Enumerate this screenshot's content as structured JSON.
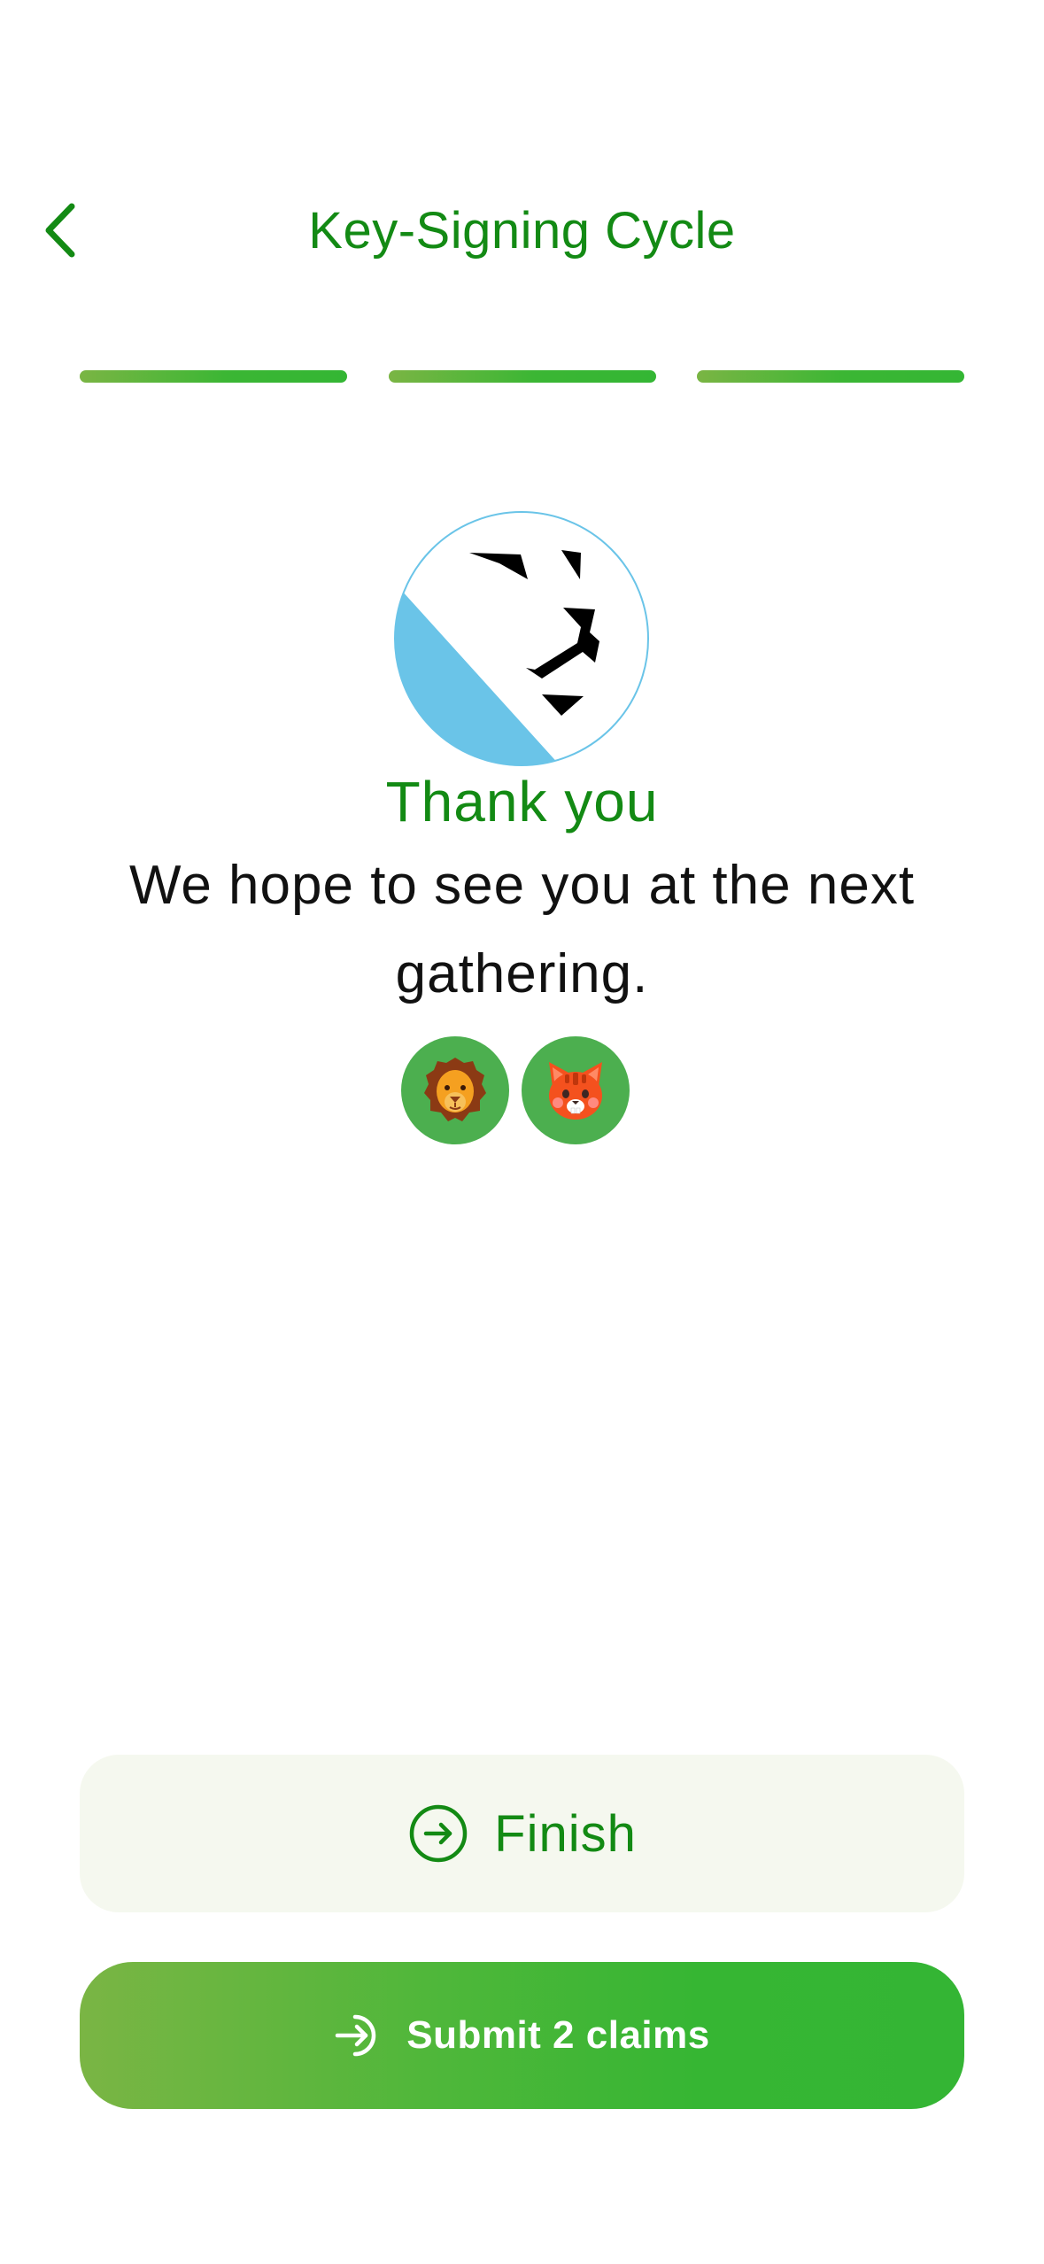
{
  "header": {
    "title": "Key-Signing Cycle",
    "back_icon": "chevron-left-icon"
  },
  "progress": {
    "total_steps": 3,
    "completed_steps": 3
  },
  "content": {
    "logo_icon": "lion-logo-icon",
    "heading": "Thank you",
    "message": "We hope to see you at the next gathering.",
    "participants": [
      {
        "icon": "lion-emoji-icon"
      },
      {
        "icon": "cat-emoji-icon"
      }
    ]
  },
  "actions": {
    "finish_label": "Finish",
    "finish_icon": "arrow-right-circle-icon",
    "submit_label": "Submit 2 claims",
    "submit_icon": "sign-in-arrow-icon"
  },
  "colors": {
    "brand_green": "#138a14",
    "accent_green": "#34b634",
    "gradient_start": "#7ab544",
    "avatar_bg": "#4caf4f",
    "logo_blue": "#6ac4e8",
    "finish_bg": "#f5f8ef"
  }
}
